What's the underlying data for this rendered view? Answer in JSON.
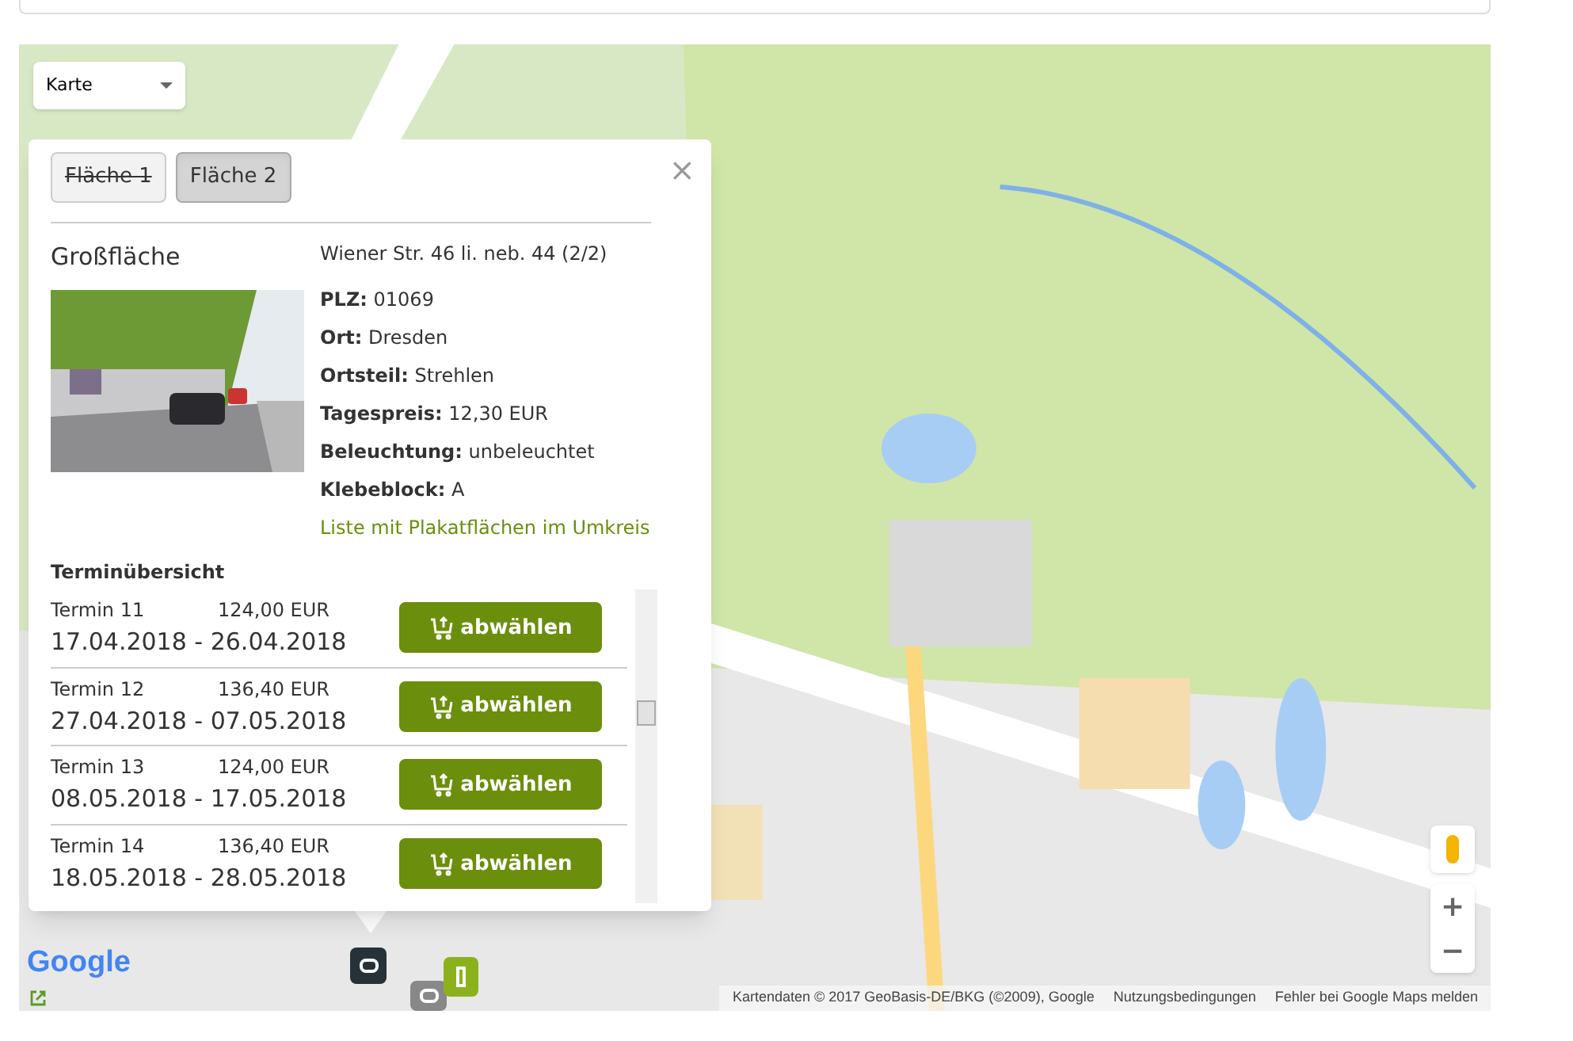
{
  "map_type": {
    "value": "Karte"
  },
  "popup": {
    "close": "×",
    "tabs": [
      {
        "label": "Fläche 1",
        "selected": false,
        "struck": true
      },
      {
        "label": "Fläche 2",
        "selected": true,
        "struck": false
      }
    ],
    "type": "Großfläche",
    "address": "Wiener Str. 46 li. neb. 44 (2/2)",
    "details": [
      {
        "label": "PLZ:",
        "value": "01069"
      },
      {
        "label": "Ort:",
        "value": "Dresden"
      },
      {
        "label": "Ortsteil:",
        "value": "Strehlen"
      },
      {
        "label": "Tagespreis:",
        "value": "12,30 EUR"
      },
      {
        "label": "Beleuchtung:",
        "value": "unbeleuchtet"
      },
      {
        "label": "Klebeblock:",
        "value": "A"
      }
    ],
    "link": "Liste mit Plakatflächen im Umkreis",
    "schedule_title": "Terminübersicht",
    "appointments": [
      {
        "name": "Termin 11",
        "price": "124,00 EUR",
        "dates": "17.04.2018 - 26.04.2018",
        "action": "abwählen"
      },
      {
        "name": "Termin 12",
        "price": "136,40 EUR",
        "dates": "27.04.2018 - 07.05.2018",
        "action": "abwählen"
      },
      {
        "name": "Termin 13",
        "price": "124,00 EUR",
        "dates": "08.05.2018 - 17.05.2018",
        "action": "abwählen"
      },
      {
        "name": "Termin 14",
        "price": "136,40 EUR",
        "dates": "18.05.2018 - 28.05.2018",
        "action": "abwählen"
      }
    ]
  },
  "logo": "Google",
  "zoom": {
    "in": "+",
    "out": "−"
  },
  "attribution": [
    "Kartendaten © 2017 GeoBasis-DE/BKG (©2009), Google",
    "Nutzungsbedingungen",
    "Fehler bei Google Maps melden"
  ]
}
